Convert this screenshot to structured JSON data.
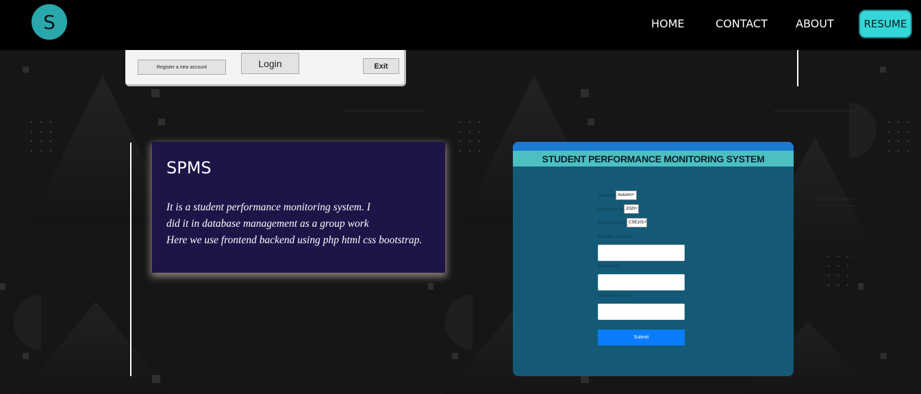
{
  "navbar": {
    "logo_letter": "S",
    "links": [
      {
        "label": "HOME"
      },
      {
        "label": "CONTACT"
      },
      {
        "label": "ABOUT"
      }
    ],
    "resume_label": "RESUME"
  },
  "login_window": {
    "register_label": "Register a new account",
    "login_label": "Login",
    "exit_label": "Exit"
  },
  "project": {
    "title": "SPMS",
    "description_lines": [
      "It is a student performance monitoring system. I",
      "did it in database management as a group work",
      "Here we use frontend backend using php html css bootstrap."
    ]
  },
  "spms_form": {
    "header": "STUDENT PERFORMANCE MONITORING SYSTEM",
    "semester_label": "Semester:",
    "semester_value": "Autumn",
    "year_label": "Semester Year:",
    "year_value": "2020",
    "course_label": "Enrolled Course:",
    "course_value": "CSE101",
    "section_label": "Enrolled Section:",
    "student_id_label": "Student ID:",
    "marks_label": "Obtained Marks:",
    "submit_label": "Submit"
  },
  "colors": {
    "accent": "#34d6d8",
    "card_bg": "#1d1447",
    "form_bg": "#145a76"
  }
}
